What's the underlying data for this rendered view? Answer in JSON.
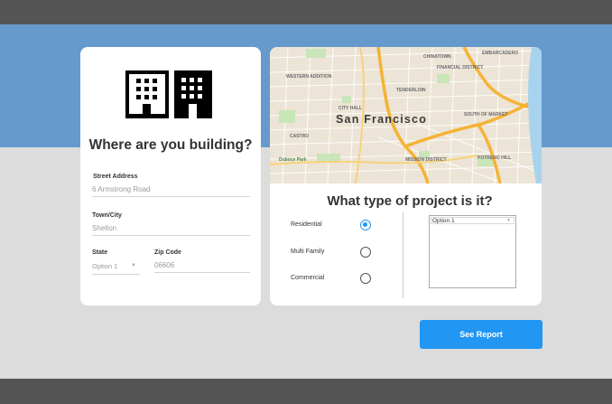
{
  "location_card": {
    "title": "Where are you building?",
    "icon": "buildings-icon",
    "street": {
      "label": "Street Address",
      "placeholder": "6 Armstrong Road"
    },
    "town": {
      "label": "Town/City",
      "placeholder": "Shelton"
    },
    "state": {
      "label": "State",
      "selected": "Option 1"
    },
    "zip": {
      "label": "Zip Code",
      "placeholder": "06606"
    }
  },
  "map": {
    "city": "San Francisco",
    "labels": [
      "CITY HALL",
      "Duboce Park",
      "MISSION DISTRICT",
      "TENDERLOIN",
      "EMBARCADERO",
      "FINANCIAL DISTRICT",
      "SOUTH OF MARKET",
      "POTRERO HILL",
      "WESTERN ADDITION",
      "CASTRO",
      "CHINATOWN"
    ]
  },
  "project_card": {
    "title": "What type of project is it?",
    "options": [
      {
        "label": "Residential",
        "checked": true
      },
      {
        "label": "Multi Family",
        "checked": false
      },
      {
        "label": "Commercial",
        "checked": false
      }
    ],
    "listbox": {
      "items": [
        "Option 1"
      ]
    }
  },
  "actions": {
    "report_label": "See Report"
  },
  "colors": {
    "topbar": "#555555",
    "band": "#6699cc",
    "background": "#dcdcdc",
    "accent": "#2196f3",
    "card": "#ffffff"
  }
}
